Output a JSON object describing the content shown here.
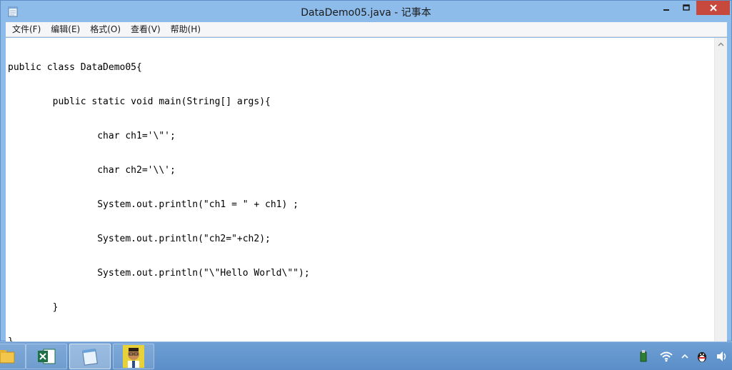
{
  "window": {
    "title": "DataDemo05.java - 记事本"
  },
  "menu": {
    "items": [
      {
        "label": "文件(F)"
      },
      {
        "label": "编辑(E)"
      },
      {
        "label": "格式(O)"
      },
      {
        "label": "查看(V)"
      },
      {
        "label": "帮助(H)"
      }
    ]
  },
  "editor": {
    "lines": [
      "public class DataDemo05{",
      "        public static void main(String[] args){",
      "                char ch1='\\\"';",
      "                char ch2='\\\\';",
      "                System.out.println(\"ch1 = \" + ch1) ;",
      "                System.out.println(\"ch2=\"+ch2);",
      "                System.out.println(\"\\\"Hello World\\\"\");",
      "        }",
      "}"
    ]
  },
  "taskbar": {
    "apps": [
      {
        "icon": "file-explorer-icon"
      },
      {
        "icon": "excel-icon"
      },
      {
        "icon": "notepad-icon",
        "active": true
      },
      {
        "icon": "avatar-app-icon"
      }
    ],
    "tray": [
      "usb-device-icon",
      "wifi-icon",
      "show-hidden-icons-chevron-icon",
      "qq-penguin-icon",
      "volume-icon"
    ]
  },
  "colors": {
    "title_bar": "#8dbbea",
    "close_button": "#c7483c",
    "taskbar": "#5b8ec8"
  }
}
